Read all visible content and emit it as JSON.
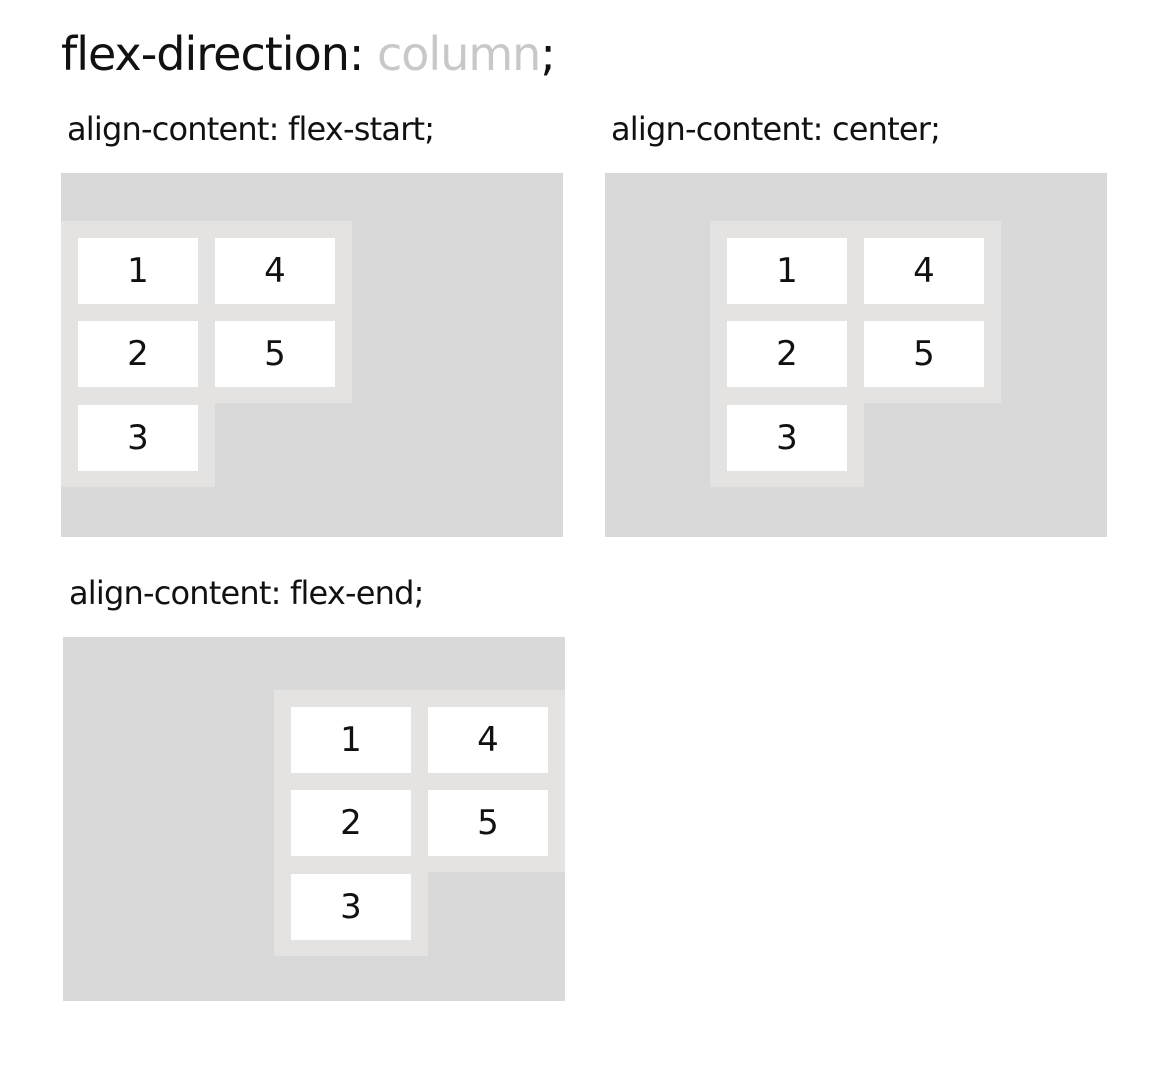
{
  "title": {
    "property": "flex-direction:",
    "value": "column",
    "semicolon": ";"
  },
  "panels": [
    {
      "label": "align-content: flex-start;",
      "items": [
        "1",
        "2",
        "3",
        "4",
        "5"
      ]
    },
    {
      "label": "align-content: center;",
      "items": [
        "1",
        "2",
        "3",
        "4",
        "5"
      ]
    },
    {
      "label": "align-content: flex-end;",
      "items": [
        "1",
        "2",
        "3",
        "4",
        "5"
      ]
    }
  ],
  "colors": {
    "container": "#d9d9d9",
    "lines": "#e4e3e2",
    "item": "#ffffff",
    "muted_value": "#c8c8c8"
  }
}
